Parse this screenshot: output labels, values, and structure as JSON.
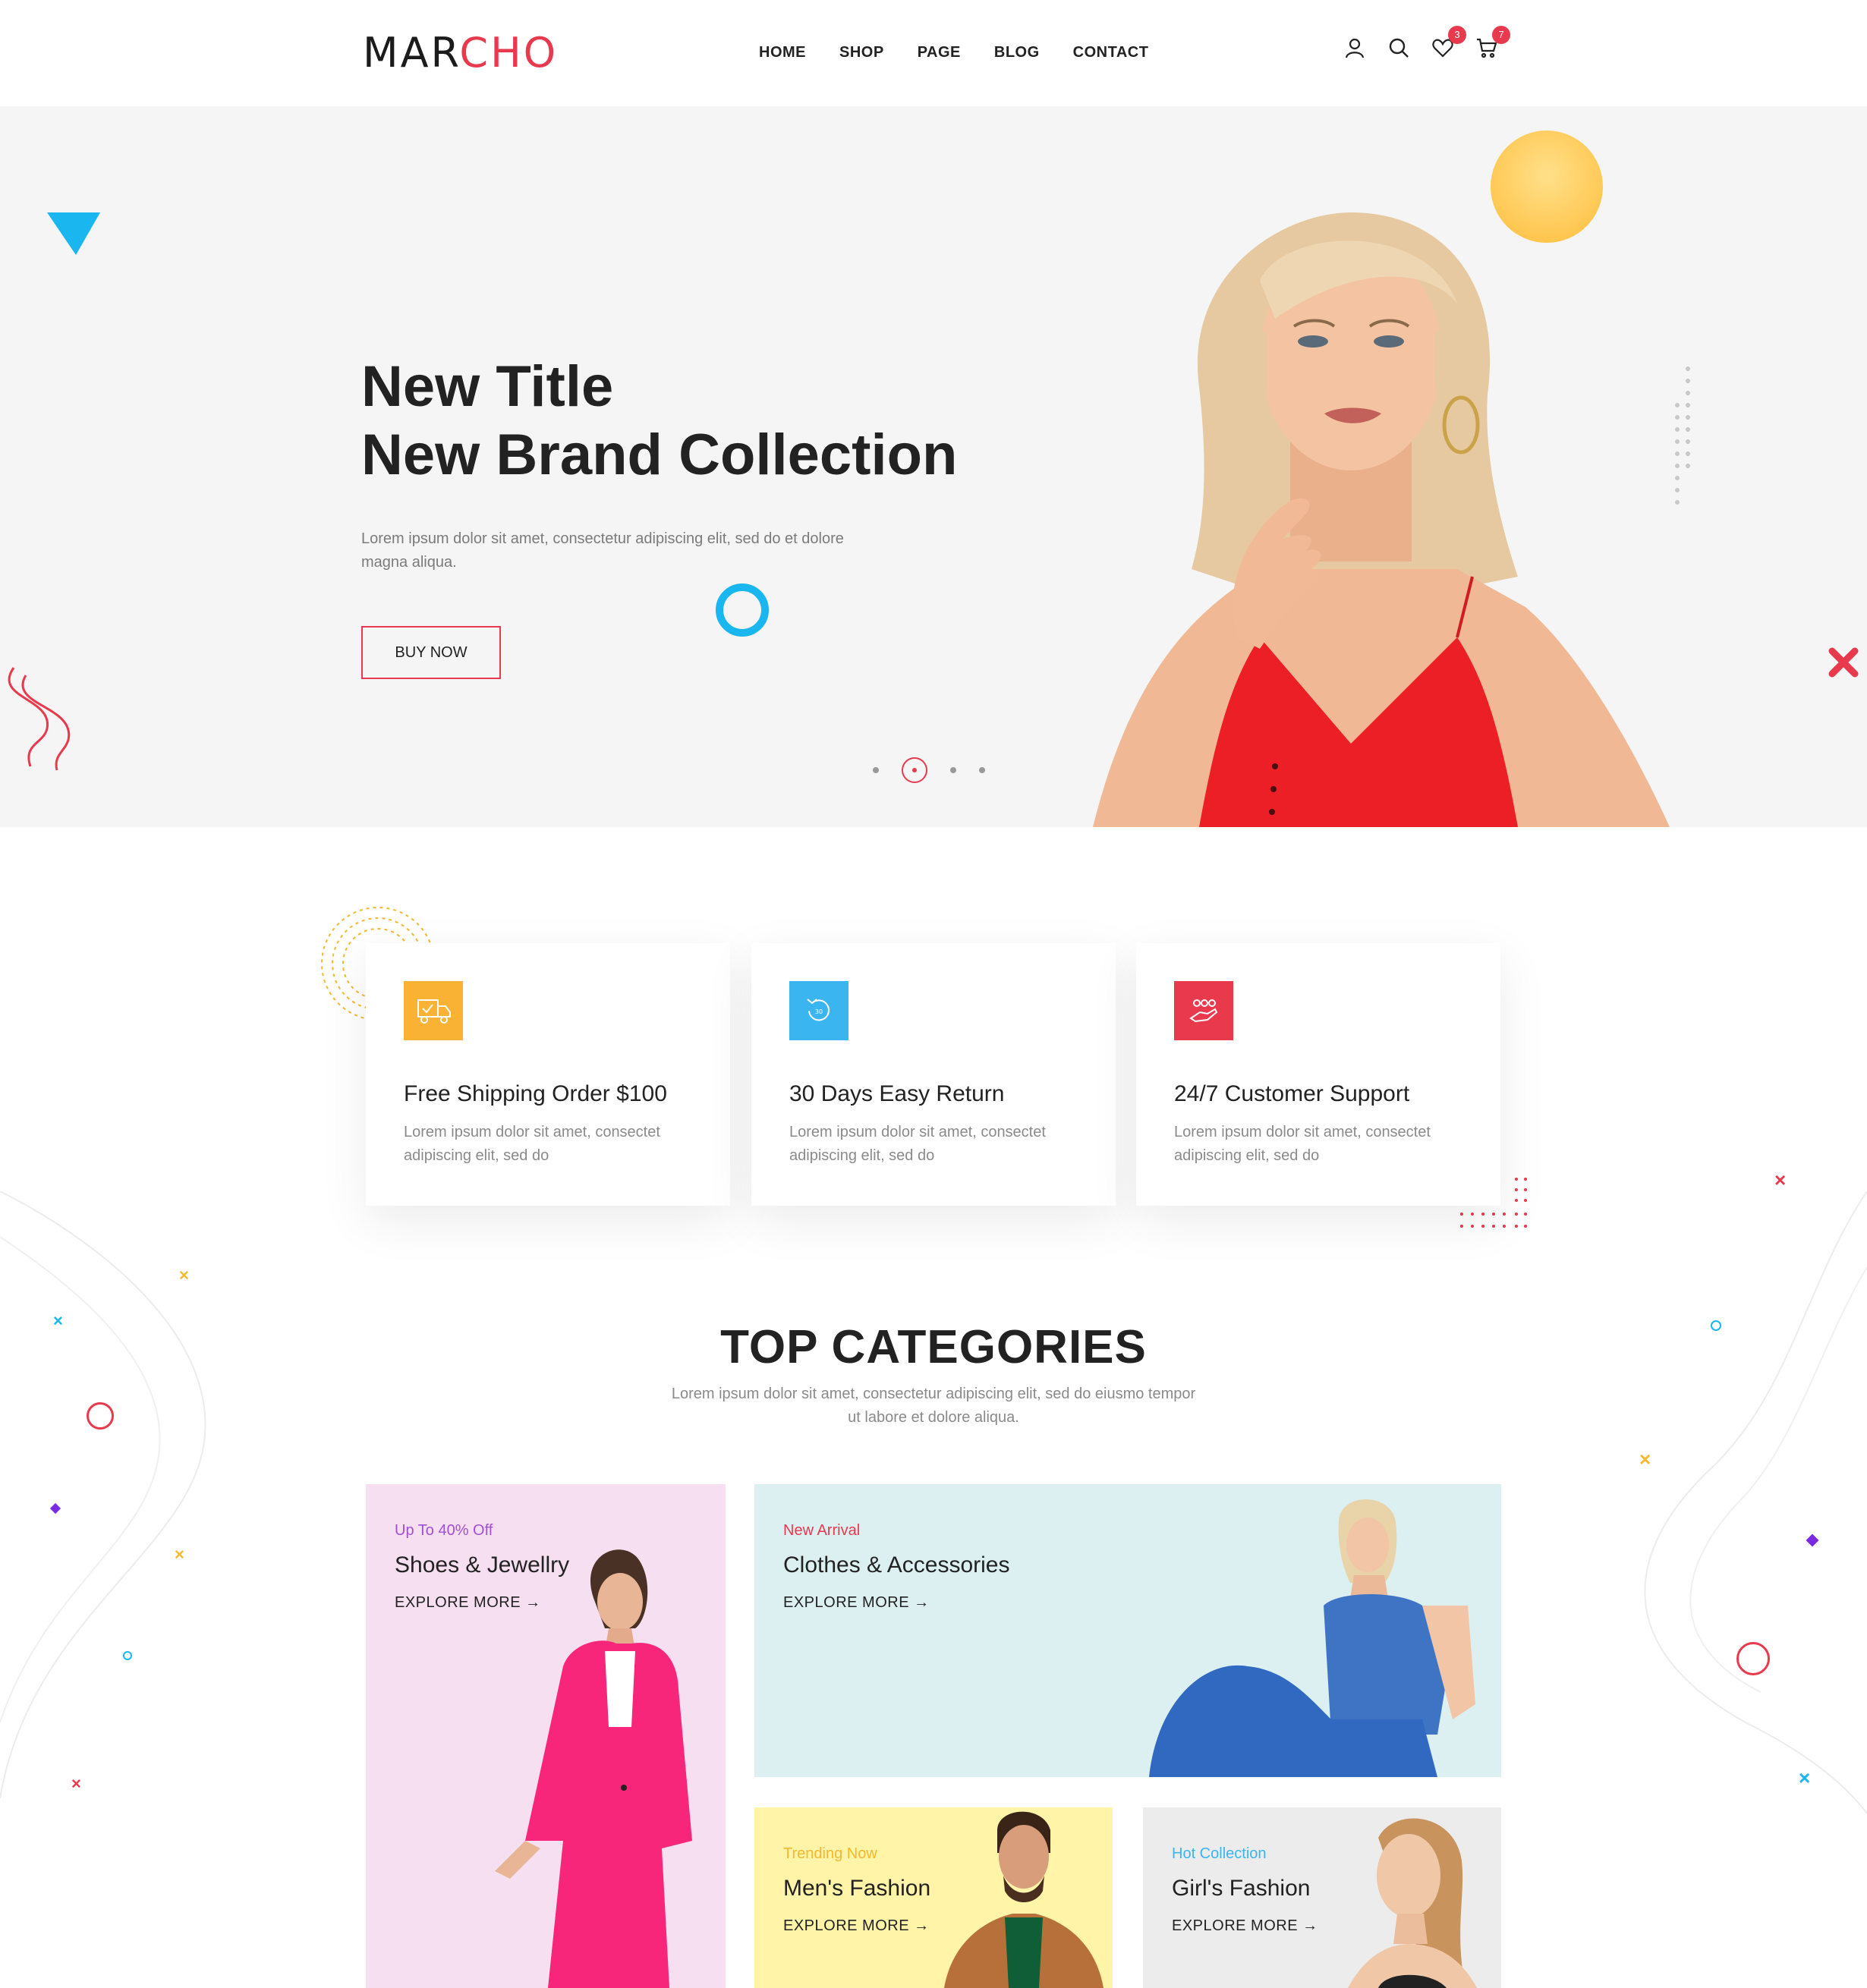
{
  "header": {
    "logo_part1": "MAR",
    "logo_part2": "CHO",
    "nav": [
      "HOME",
      "SHOP",
      "PAGE",
      "BLOG",
      "CONTACT"
    ],
    "wishlist_count": "3",
    "cart_count": "7"
  },
  "hero": {
    "title_line1": "New Title",
    "title_line2": "New Brand Collection",
    "description": "Lorem ipsum dolor sit amet, consectetur adipiscing elit, sed do et dolore magna aliqua.",
    "button": "BUY NOW",
    "slides_count": 4,
    "active_slide": 2
  },
  "features": [
    {
      "title": "Free Shipping Order $100",
      "description": "Lorem ipsum dolor sit amet, consectet adipiscing elit, sed do",
      "icon": "truck-icon",
      "color": "#f9b233"
    },
    {
      "title": "30 Days Easy Return",
      "description": "Lorem ipsum dolor sit amet, consectet adipiscing elit, sed do",
      "icon": "return-icon",
      "color": "#3bb5ef"
    },
    {
      "title": "24/7 Customer Support",
      "description": "Lorem ipsum dolor sit amet, consectet adipiscing elit, sed do",
      "icon": "support-icon",
      "color": "#e8394d"
    }
  ],
  "categories": {
    "title": "TOP CATEGORIES",
    "description": "Lorem ipsum dolor sit amet, consectetur adipiscing elit, sed do eiusmo tempor ut labore et dolore aliqua.",
    "items": [
      {
        "tag": "Up To 40% Off",
        "name": "Shoes & Jewellry",
        "more": "EXPLORE MORE →",
        "tag_color": "#a14fd3",
        "bg": "#f5dff0"
      },
      {
        "tag": "New Arrival",
        "name": "Clothes & Accessories",
        "more": "EXPLORE MORE →",
        "tag_color": "#e8394d",
        "bg": "#dcf0f2"
      },
      {
        "tag": "Trending Now",
        "name": "Men's Fashion",
        "more": "EXPLORE MORE →",
        "tag_color": "#f5b82e",
        "bg": "#fff4a8"
      },
      {
        "tag": "Hot Collection",
        "name": "Girl's Fashion",
        "more": "EXPLORE MORE →",
        "tag_color": "#3bb5ef",
        "bg": "#ececec"
      }
    ]
  },
  "colors": {
    "accent": "#e8394d",
    "dark": "#222222",
    "muted": "#8a8a8a"
  }
}
